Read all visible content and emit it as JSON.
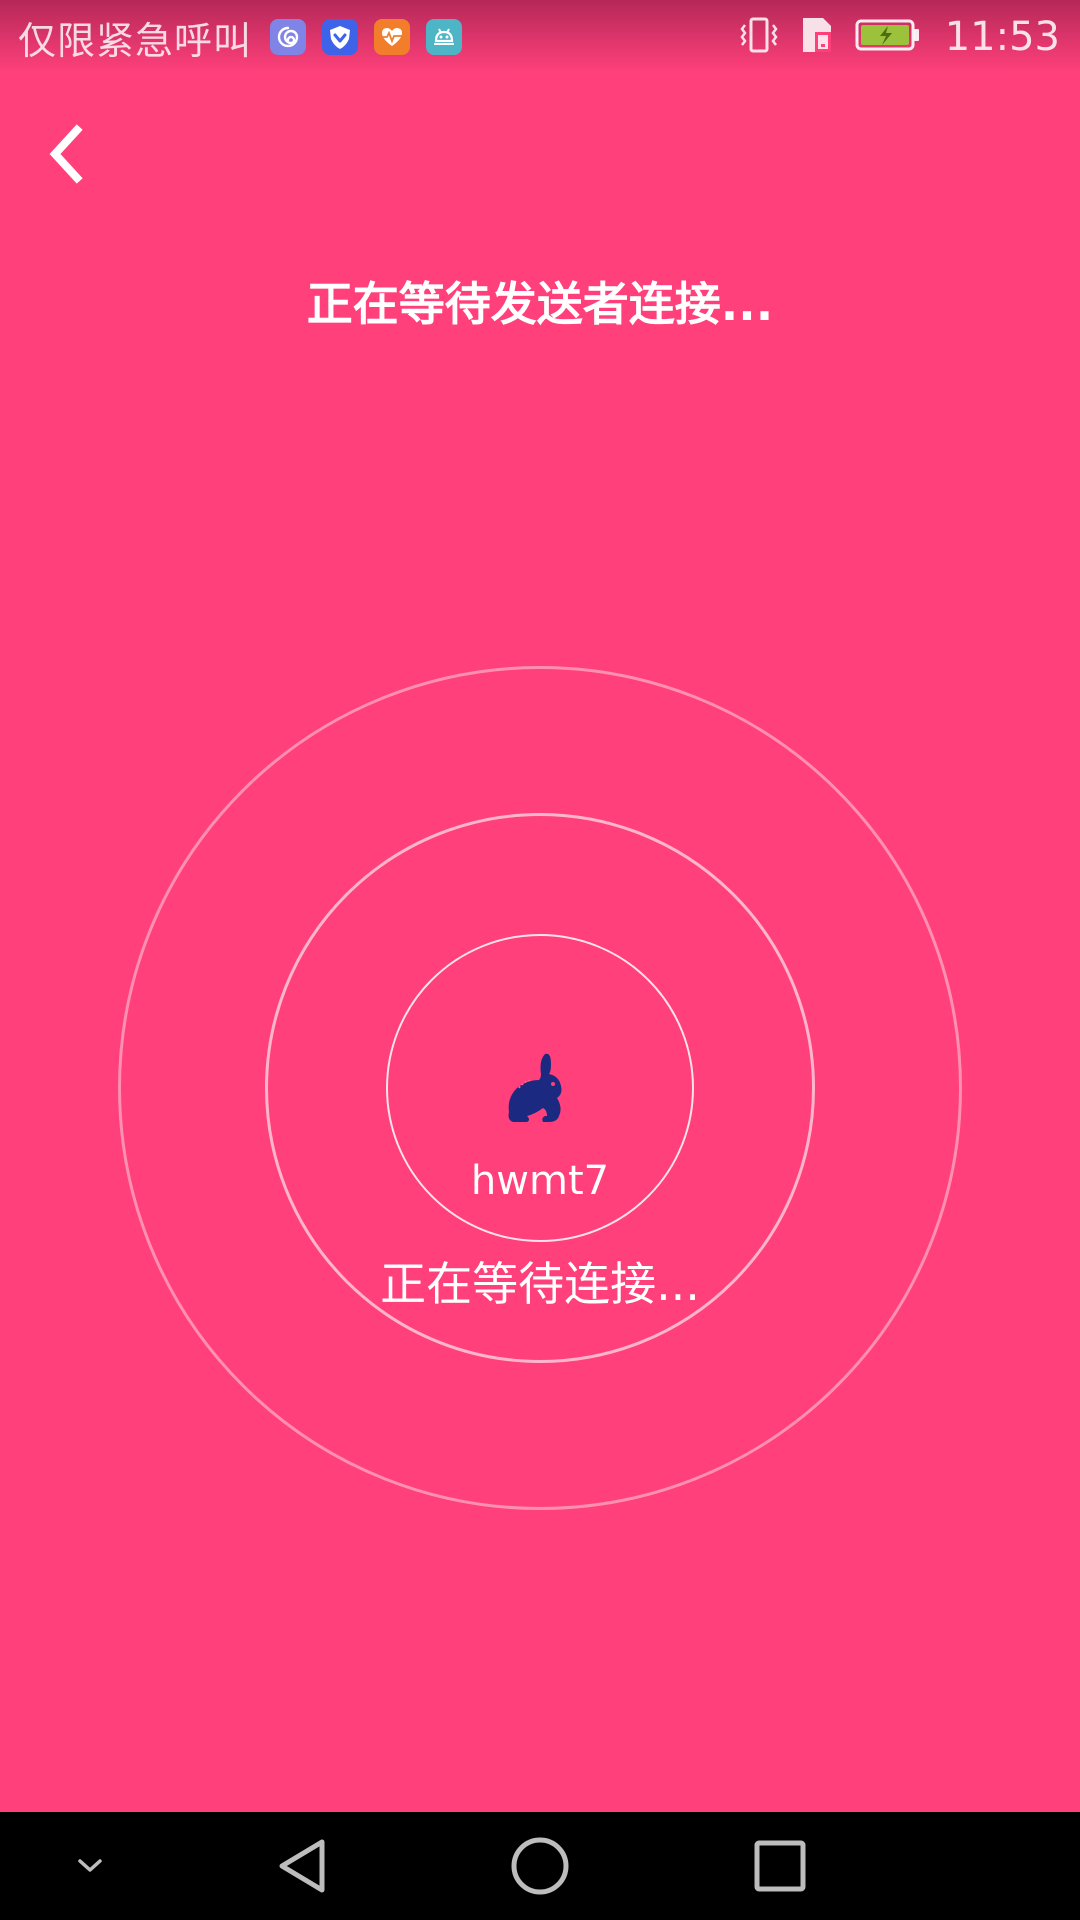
{
  "status_bar": {
    "emergency_text": "仅限紧急呼叫",
    "app_icons": [
      {
        "name": "swirl-app-icon",
        "color": "#7f84e6"
      },
      {
        "name": "shield-app-icon",
        "color": "#3f63e8"
      },
      {
        "name": "health-app-icon",
        "color": "#f27d2a"
      },
      {
        "name": "android-app-icon",
        "color": "#4db5c6"
      }
    ],
    "indicators": [
      "vibrate-icon",
      "sim-card-icon",
      "battery-charging-icon"
    ],
    "clock": "11:53"
  },
  "header": {
    "back_icon": "chevron-left-icon",
    "title": "正在等待发送者连接..."
  },
  "radar": {
    "device_icon": "rabbit-icon",
    "device_icon_color": "#1b2a80",
    "device_name": "hwmt7",
    "status": "正在等待连接..."
  },
  "navbar": {
    "buttons": [
      "collapse-icon",
      "back-triangle-icon",
      "home-circle-icon",
      "recents-square-icon"
    ]
  },
  "theme": {
    "background": "#ff407b",
    "text": "#ffffff"
  }
}
